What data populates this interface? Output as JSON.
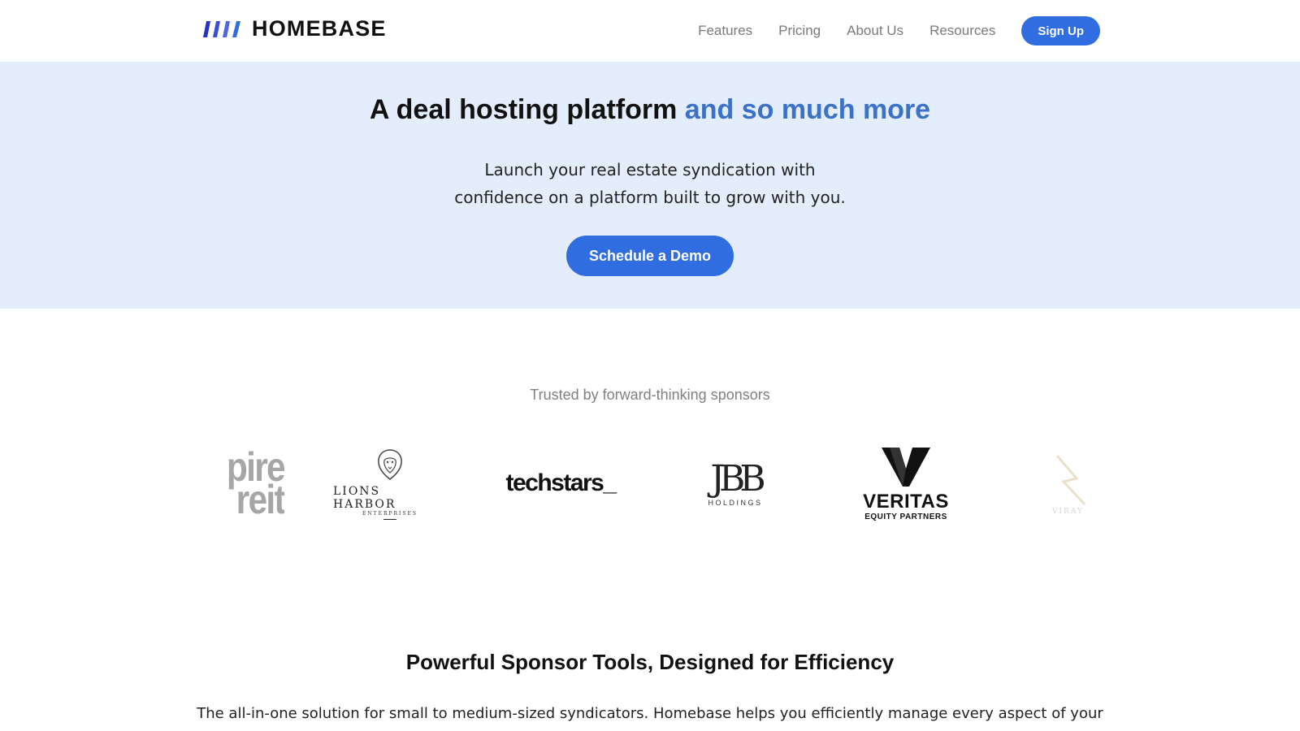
{
  "brand": {
    "name": "HOMEBASE",
    "accent": "#2f6de1"
  },
  "nav": {
    "links": [
      "Features",
      "Pricing",
      "About Us",
      "Resources"
    ],
    "signup_label": "Sign Up"
  },
  "hero": {
    "title_main": "A deal hosting platform ",
    "title_accent": "and so much more",
    "subtitle_line1": "Launch your real estate syndication with",
    "subtitle_line2": "confidence on a platform built to grow with you.",
    "cta_label": "Schedule a Demo",
    "background": "#e4edfb"
  },
  "trusted": {
    "label": "Trusted by forward-thinking sponsors",
    "logos": [
      {
        "name": "pire reit",
        "line1": "pire",
        "line2": "reit"
      },
      {
        "name": "Lions Harbor Enterprises",
        "title": "LIONS HARBOR",
        "sub": "ENTERPRISES"
      },
      {
        "name": "techstars",
        "text": "techstars_"
      },
      {
        "name": "JBB Holdings",
        "mark": "JBB",
        "sub": "HOLDINGS"
      },
      {
        "name": "Veritas Equity Partners",
        "title": "VERITAS",
        "sub": "EQUITY PARTNERS"
      },
      {
        "name": "partial logo",
        "text": "VIRAY"
      }
    ]
  },
  "tools": {
    "title": "Powerful Sponsor Tools, Designed for Efficiency",
    "description": "The all-in-one solution for small to medium-sized syndicators. Homebase helps you efficiently manage every aspect of your"
  }
}
